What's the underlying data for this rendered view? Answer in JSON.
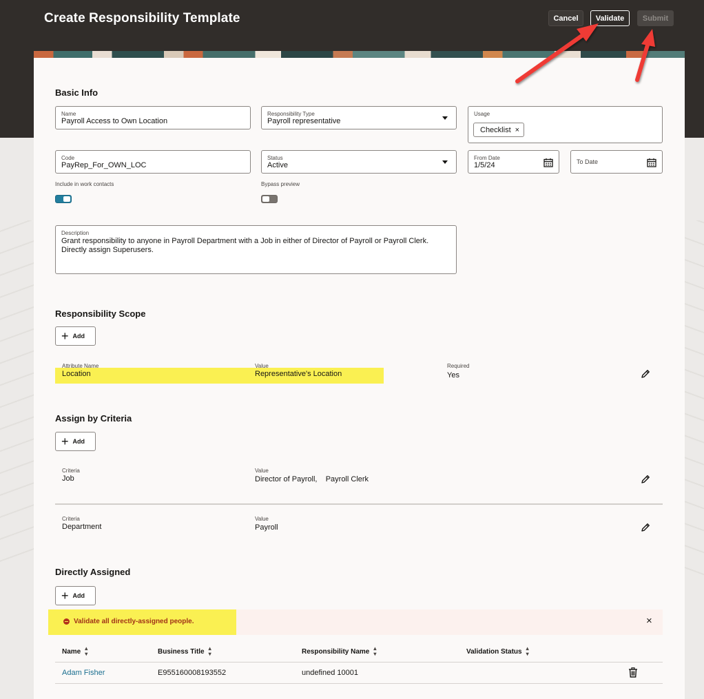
{
  "header": {
    "title": "Create Responsibility Template",
    "cancel_label": "Cancel",
    "validate_label": "Validate",
    "submit_label": "Submit"
  },
  "basic_info": {
    "section_title": "Basic Info",
    "name": {
      "label": "Name",
      "value": "Payroll Access to Own Location"
    },
    "responsibility_type": {
      "label": "Responsibility Type",
      "value": "Payroll representative"
    },
    "usage": {
      "label": "Usage",
      "chips": [
        "Checklist"
      ],
      "chip_remove": "×"
    },
    "code": {
      "label": "Code",
      "value": "PayRep_For_OWN_LOC"
    },
    "status": {
      "label": "Status",
      "value": "Active"
    },
    "from_date": {
      "label": "From Date",
      "value": "1/5/24"
    },
    "to_date": {
      "label": "To Date",
      "value": ""
    },
    "include_work_contacts": {
      "label": "Include in work contacts",
      "on": true
    },
    "bypass_preview": {
      "label": "Bypass preview",
      "on": false
    },
    "description": {
      "label": "Description",
      "line1": "Grant responsibility to anyone in Payroll Department with a Job in either of Director of Payroll or Payroll Clerk.",
      "line2": "Directly assign Superusers."
    }
  },
  "responsibility_scope": {
    "section_title": "Responsibility Scope",
    "add_label": "Add",
    "row": {
      "attribute_name_label": "Attribute Name",
      "attribute_name": "Location",
      "value_label": "Value",
      "value": "Representative's Location",
      "required_label": "Required",
      "required": "Yes"
    }
  },
  "assign_by_criteria": {
    "section_title": "Assign by Criteria",
    "add_label": "Add",
    "rows": [
      {
        "criteria_label": "Criteria",
        "criteria": "Job",
        "value_label": "Value",
        "value": "Director of Payroll,    Payroll Clerk"
      },
      {
        "criteria_label": "Criteria",
        "criteria": "Department",
        "value_label": "Value",
        "value": "Payroll"
      }
    ]
  },
  "directly_assigned": {
    "section_title": "Directly Assigned",
    "add_label": "Add",
    "alert": {
      "message": "Validate all directly-assigned people.",
      "close": "×"
    },
    "columns": [
      "Name",
      "Business Title",
      "Responsibility Name",
      "Validation Status"
    ],
    "rows": [
      {
        "name": "Adam Fisher",
        "business_title": "E955160008193552",
        "responsibility_name": "undefined 10001",
        "validation_status": ""
      }
    ]
  },
  "colors": {
    "header_bg": "#312d2a",
    "highlight": "#faf052",
    "accent_toggle": "#227e9e",
    "error": "#a13318",
    "link": "#1a6e8f",
    "annotation_arrow": "#ef3b36"
  },
  "icons": [
    "calendar-icon",
    "chevron-down-icon",
    "plus-icon",
    "pencil-icon",
    "error-icon",
    "close-icon",
    "sort-icon",
    "trash-icon"
  ]
}
